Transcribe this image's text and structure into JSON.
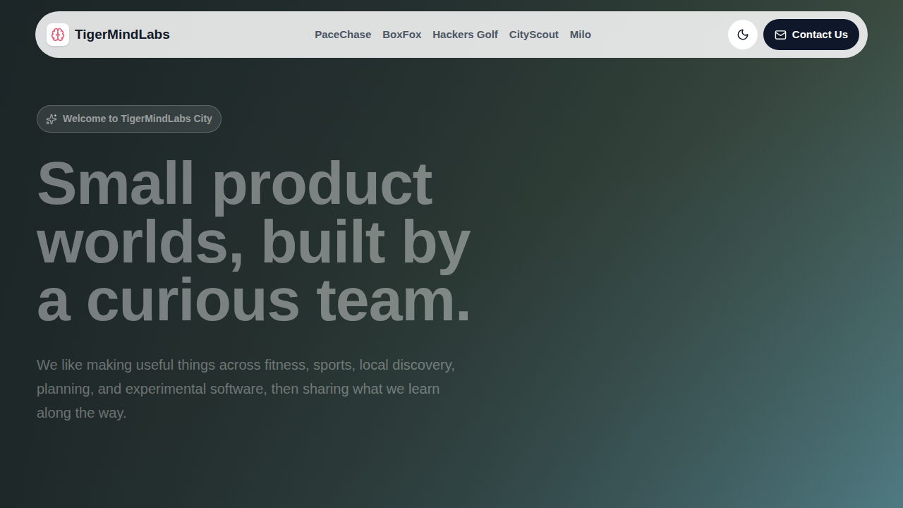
{
  "nav": {
    "brand": "TigerMindLabs",
    "links": [
      {
        "label": "PaceChase",
        "selected": false
      },
      {
        "label": "BoxFox",
        "selected": false
      },
      {
        "label": "Hackers Golf",
        "selected": false
      },
      {
        "label": "CityScout",
        "selected": false
      },
      {
        "label": "Milo",
        "selected": false
      }
    ],
    "contact": "Contact Us"
  },
  "hero": {
    "badge": "Welcome to TigerMindLabs City",
    "title_lines": [
      "Small product",
      "worlds, built by",
      "a curious team."
    ],
    "subtitle_lines": [
      "We like making useful things across fitness, sports, local discovery,",
      "planning, and experimental software, then sharing what we learn",
      "along the way."
    ]
  }
}
